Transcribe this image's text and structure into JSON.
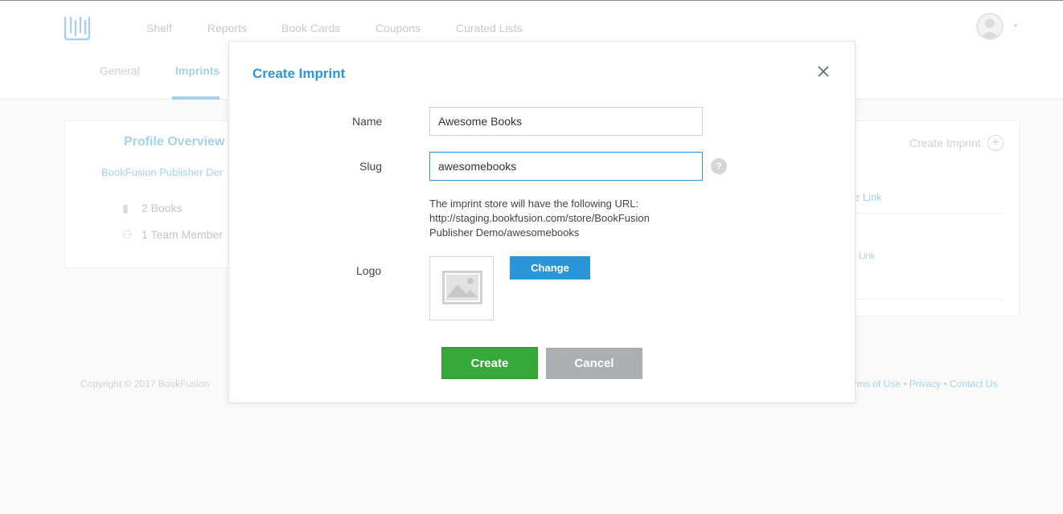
{
  "app": {
    "nav": [
      "Shelf",
      "Reports",
      "Book Cards",
      "Coupons",
      "Curated Lists"
    ],
    "subtabs": [
      "General",
      "Imprints"
    ],
    "active_subtab": "Imprints"
  },
  "profile": {
    "title": "Profile Overview",
    "publisher_name": "BookFusion Publisher Der",
    "books": "2 Books",
    "team": "1 Team Member"
  },
  "imprints_panel": {
    "create_link": "Create Imprint",
    "link1": "e Link",
    "link2": "Link"
  },
  "footer": {
    "copyright": "Copyright © 2017 BookFusion",
    "terms": "rms of Use",
    "sep1": " • ",
    "privacy": "Privacy",
    "sep2": " • ",
    "contact": "Contact Us"
  },
  "modal": {
    "title": "Create Imprint",
    "name_label": "Name",
    "name_value": "Awesome Books",
    "slug_label": "Slug",
    "slug_value": "awesomebooks",
    "help_glyph": "?",
    "url_note_1": "The imprint store will have the following URL:",
    "url_note_2": "http://staging.bookfusion.com/store/BookFusion",
    "url_note_3": "Publisher Demo/awesomebooks",
    "logo_label": "Logo",
    "change_label": "Change",
    "create_label": "Create",
    "cancel_label": "Cancel"
  },
  "colors": {
    "accent": "#2a95d8",
    "create": "#37a93a",
    "cancel": "#a9afb2"
  },
  "icons": [
    "app-logo-icon",
    "user-avatar-icon",
    "book-icon",
    "team-icon",
    "plus-icon",
    "close-icon",
    "help-icon",
    "image-placeholder-icon"
  ]
}
